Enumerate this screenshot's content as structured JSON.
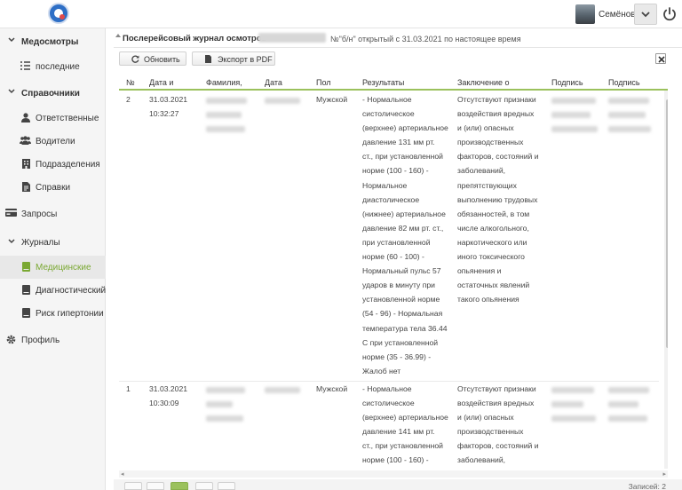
{
  "header": {
    "user_name": "Семёнов...",
    "accent": "#7aa832"
  },
  "sidebar": {
    "items": [
      {
        "label": "Медосмотры",
        "icon": "chevron-down-icon"
      },
      {
        "label": "последние",
        "icon": "list-icon"
      },
      {
        "label": "Справочники",
        "icon": "chevron-down-icon"
      },
      {
        "label": "Ответственные",
        "icon": "person-icon"
      },
      {
        "label": "Водители",
        "icon": "people-icon"
      },
      {
        "label": "Подразделения",
        "icon": "building-icon"
      },
      {
        "label": "Справки",
        "icon": "document-icon"
      },
      {
        "label": "Запросы",
        "icon": "card-icon"
      },
      {
        "label": "Журналы",
        "icon": "chevron-down-icon"
      },
      {
        "label": "Медицинские",
        "icon": "book-icon"
      },
      {
        "label": "Диагностический",
        "icon": "book-icon"
      },
      {
        "label": "Риск гипертонии",
        "icon": "book-icon"
      },
      {
        "label": "Профиль",
        "icon": "gear-icon"
      }
    ]
  },
  "panel": {
    "title": "Послерейсовый журнал осмотров",
    "subtitle": "№\"б/н\" открытый с 31.03.2021 по настоящее время",
    "refresh_label": "Обновить",
    "export_label": "Экспорт в PDF"
  },
  "table": {
    "columns": [
      "№",
      "Дата и",
      "Фамилия,",
      "Дата",
      "Пол",
      "Результаты",
      "Заключение о",
      "Подпись",
      "Подпись"
    ],
    "rows": [
      {
        "num": "2",
        "date": "31.03.2021",
        "time": "10:32:27",
        "sex": "Мужской",
        "results": [
          "- Нормальное",
          "систолическое",
          "(верхнее) артериальное",
          "давление 131 мм рт.",
          "ст., при установленной",
          "норме (100 - 160) -",
          "Нормальное",
          "диастолическое",
          "(нижнее) артериальное",
          "давление 82 мм рт. ст.,",
          "при установленной",
          "норме (60 - 100) -",
          "Нормальный пульс 57",
          "ударов в минуту при",
          "установленной норме",
          "(54 - 96) - Нормальная",
          "температура тела 36.44",
          "С при установленной",
          "норме (35 - 36.99) -",
          "Жалоб нет"
        ],
        "conclusion": [
          "Отсутствуют признаки",
          "воздействия вредных",
          "и (или) опасных",
          "производственных",
          "факторов, состояний и",
          "заболеваний,",
          "препятствующих",
          "выполнению трудовых",
          "обязанностей, в том",
          "числе алкогольного,",
          "наркотического или",
          "иного токсического",
          "опьянения и",
          "остаточных явлений",
          "такого опьянения"
        ]
      },
      {
        "num": "1",
        "date": "31.03.2021",
        "time": "10:30:09",
        "sex": "Мужской",
        "results": [
          "- Нормальное",
          "систолическое",
          "(верхнее) артериальное",
          "давление 141 мм рт.",
          "ст., при установленной",
          "норме (100 - 160) -"
        ],
        "conclusion": [
          "Отсутствуют признаки",
          "воздействия вредных",
          "и (или) опасных",
          "производственных",
          "факторов, состояний и",
          "заболеваний,"
        ]
      }
    ]
  },
  "pager": {
    "info": "Записей: 2"
  }
}
